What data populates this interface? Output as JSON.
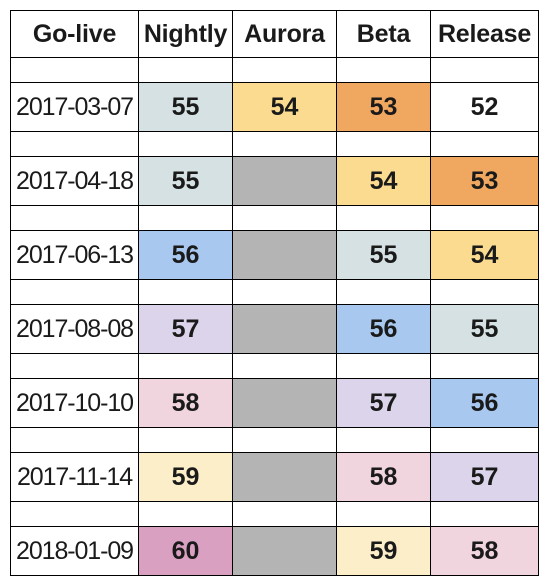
{
  "table": {
    "name": "firefox-release-train-matrix",
    "columns": [
      "Go-live",
      "Nightly",
      "Aurora",
      "Beta",
      "Release"
    ],
    "palette": {
      "white": "#ffffff",
      "gray": "#b4b4b4",
      "ice_blue": "#d5e1e2",
      "blue": "#a8c8f0",
      "lavender": "#dcd4ea",
      "pink": "#f0d4de",
      "cream": "#fbeec9",
      "gold": "#fadb8f",
      "orange": "#f0a860",
      "mauve": "#d9a0c2"
    },
    "rows": [
      {
        "date": "2017-03-07",
        "cells": [
          {
            "value": "55",
            "color": "#d5e1e2"
          },
          {
            "value": "54",
            "color": "#fadb8f"
          },
          {
            "value": "53",
            "color": "#f0a860"
          },
          {
            "value": "52",
            "color": "#ffffff"
          }
        ]
      },
      {
        "date": "2017-04-18",
        "cells": [
          {
            "value": "55",
            "color": "#d5e1e2"
          },
          {
            "value": "",
            "color": "#b4b4b4"
          },
          {
            "value": "54",
            "color": "#fadb8f"
          },
          {
            "value": "53",
            "color": "#f0a860"
          }
        ]
      },
      {
        "date": "2017-06-13",
        "cells": [
          {
            "value": "56",
            "color": "#a8c8f0"
          },
          {
            "value": "",
            "color": "#b4b4b4"
          },
          {
            "value": "55",
            "color": "#d5e1e2"
          },
          {
            "value": "54",
            "color": "#fadb8f"
          }
        ]
      },
      {
        "date": "2017-08-08",
        "cells": [
          {
            "value": "57",
            "color": "#dcd4ea"
          },
          {
            "value": "",
            "color": "#b4b4b4"
          },
          {
            "value": "56",
            "color": "#a8c8f0"
          },
          {
            "value": "55",
            "color": "#d5e1e2"
          }
        ]
      },
      {
        "date": "2017-10-10",
        "cells": [
          {
            "value": "58",
            "color": "#f0d4de"
          },
          {
            "value": "",
            "color": "#b4b4b4"
          },
          {
            "value": "57",
            "color": "#dcd4ea"
          },
          {
            "value": "56",
            "color": "#a8c8f0"
          }
        ]
      },
      {
        "date": "2017-11-14",
        "cells": [
          {
            "value": "59",
            "color": "#fbeec9"
          },
          {
            "value": "",
            "color": "#b4b4b4"
          },
          {
            "value": "58",
            "color": "#f0d4de"
          },
          {
            "value": "57",
            "color": "#dcd4ea"
          }
        ]
      },
      {
        "date": "2018-01-09",
        "cells": [
          {
            "value": "60",
            "color": "#d9a0c2"
          },
          {
            "value": "",
            "color": "#b4b4b4"
          },
          {
            "value": "59",
            "color": "#fbeec9"
          },
          {
            "value": "58",
            "color": "#f0d4de"
          }
        ]
      }
    ]
  }
}
